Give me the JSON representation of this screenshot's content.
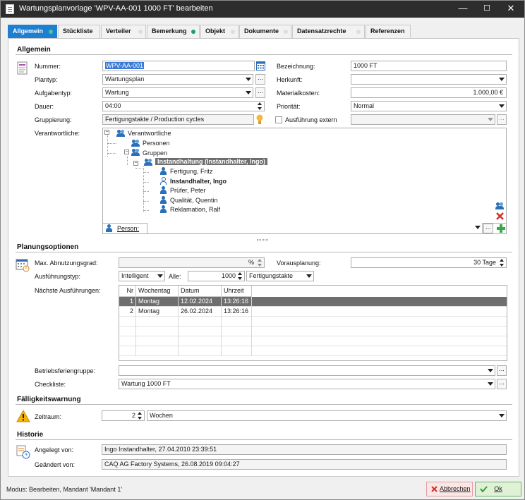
{
  "window": {
    "title": "Wartungsplanvorlage 'WPV-AA-001 1000 FT' bearbeiten",
    "min_glyph": "—",
    "max_glyph": "☐",
    "close_glyph": "✕"
  },
  "tabs": [
    {
      "label": "Allgemein",
      "active": true,
      "dot": "green"
    },
    {
      "label": "Stückliste"
    },
    {
      "label": "Verteiler",
      "dot": "grey"
    },
    {
      "label": "Bemerkung",
      "dot": "green"
    },
    {
      "label": "Objekt",
      "dot": "grey"
    },
    {
      "label": "Dokumente",
      "dot": "grey"
    },
    {
      "label": "Datensatzrechte",
      "dot": "grey"
    },
    {
      "label": "Referenzen"
    }
  ],
  "allgemein": {
    "heading": "Allgemein",
    "nummer_label": "Nummer:",
    "nummer_value": "WPV-AA-001",
    "plantyp_label": "Plantyp:",
    "plantyp_value": "Wartungsplan",
    "aufgabentyp_label": "Aufgabentyp:",
    "aufgabentyp_value": "Wartung",
    "dauer_label": "Dauer:",
    "dauer_value": "04:00",
    "gruppierung_label": "Gruppierung:",
    "gruppierung_value": "Fertigungstakte / Production cycles",
    "verantwortliche_label": "Verantwortliche:",
    "bezeichnung_label": "Bezeichnung:",
    "bezeichnung_value": "1000 FT",
    "herkunft_label": "Herkunft:",
    "herkunft_value": "",
    "materialkosten_label": "Materialkosten:",
    "materialkosten_value": "1.000,00 €",
    "prioritaet_label": "Priorität:",
    "prioritaet_value": "Normal",
    "ausfuehrung_extern_label": "Ausführung extern",
    "ausfuehrung_extern_value": "",
    "dots": "..."
  },
  "tree": {
    "root": "Verantwortliche",
    "personen": "Personen",
    "gruppen": "Gruppen",
    "group_selected": "Instandhaltung (Instandhalter, Ingo)",
    "members": [
      "Fertigung, Fritz",
      "Instandhalter, Ingo",
      "Prüfer, Peter",
      "Qualität, Quentin",
      "Reklamation, Ralf"
    ],
    "person_label": "Person:",
    "person_value": "",
    "expander_minus": "−"
  },
  "planungsoptionen": {
    "heading": "Planungsoptionen",
    "abnutzungsgrad_label": "Max. Abnutzungsgrad:",
    "abnutzungsgrad_unit": "%",
    "vorausplanung_label": "Vorausplanung:",
    "vorausplanung_value": "30 Tage",
    "ausfuehrungstyp_label": "Ausführungstyp:",
    "ausfuehrungstyp_value": "Intelligent",
    "alle_label": "Alle:",
    "alle_value": "1000",
    "alle_unit": "Fertigungstakte",
    "naechste_label": "Nächste Ausführungen:",
    "columns": [
      "Nr",
      "Wochentag",
      "Datum",
      "Uhrzeit"
    ],
    "rows": [
      {
        "nr": "1",
        "wochentag": "Montag",
        "datum": "12.02.2024",
        "uhrzeit": "13:26:16"
      },
      {
        "nr": "2",
        "wochentag": "Montag",
        "datum": "26.02.2024",
        "uhrzeit": "13:26:16"
      }
    ],
    "betriebsferien_label": "Betriebsferiengruppe:",
    "betriebsferien_value": "",
    "checkliste_label": "Checkliste:",
    "checkliste_value": "Wartung 1000 FT"
  },
  "faelligkeit": {
    "heading": "Fälligkeitswarnung",
    "zeitraum_label": "Zeitraum:",
    "zeitraum_value": "2",
    "zeitraum_unit": "Wochen"
  },
  "historie": {
    "heading": "Historie",
    "angelegt_label": "Angelegt von:",
    "angelegt_value": "Ingo Instandhalter, 27.04.2010 23:39:51",
    "geaendert_label": "Geändert von:",
    "geaendert_value": "CAQ AG Factory Systems, 26.08.2019 09:04:27"
  },
  "status": "Modus: Bearbeiten, Mandant 'Mandant 1'",
  "buttons": {
    "abbrechen": "Abbrechen",
    "ok": "Ok"
  },
  "colors": {
    "accent": "#1d7fd1",
    "titlebar": "#2d2d2d",
    "selection": "#6e6e6e",
    "ok_green": "#5cb85c",
    "cancel_red": "#d9534f"
  }
}
